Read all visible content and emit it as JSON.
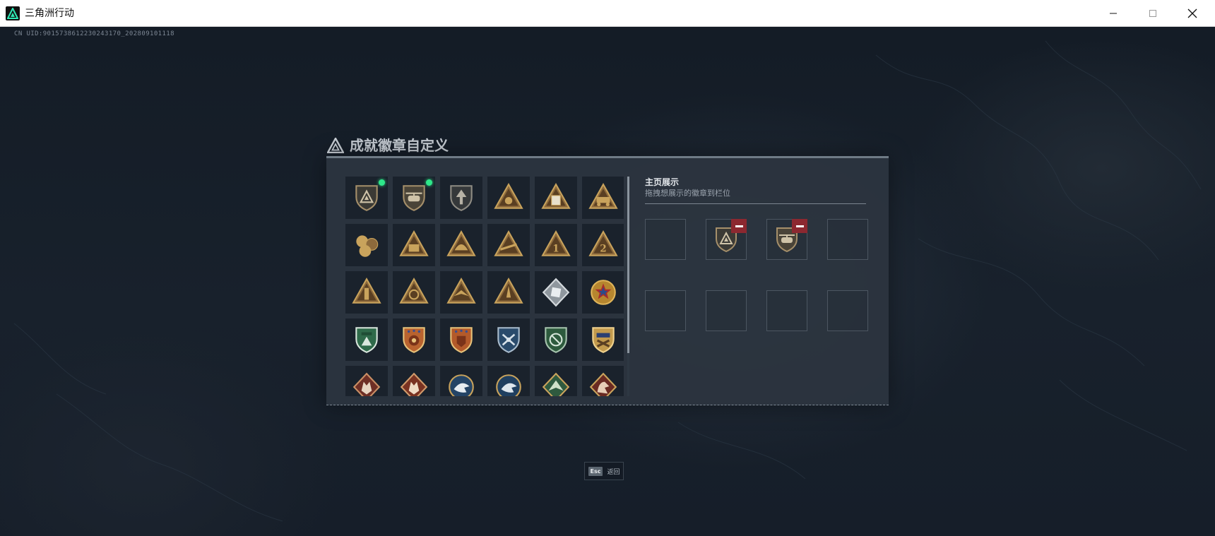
{
  "window": {
    "title": "三角洲行动",
    "controls": {
      "minimize": "minimize-icon",
      "maximize": "maximize-icon",
      "close": "close-icon"
    }
  },
  "uid_text": "CN UID:9015738612230243170_202809101118",
  "dialog": {
    "title": "成就徽章自定义",
    "badges": [
      {
        "icon": "shield-delta-badge",
        "new": true
      },
      {
        "icon": "helicopter-shield-badge",
        "new": true
      },
      {
        "icon": "arrowhead-shield-badge",
        "new": false
      },
      {
        "icon": "gold-triangle-badge",
        "new": false
      },
      {
        "icon": "triangle-card-badge",
        "new": false
      },
      {
        "icon": "triangle-vehicle-badge",
        "new": false
      },
      {
        "icon": "gold-cluster-badge",
        "new": false
      },
      {
        "icon": "triangle-kit-badge",
        "new": false
      },
      {
        "icon": "triangle-helmet-badge",
        "new": false
      },
      {
        "icon": "triangle-rifle-badge",
        "new": false
      },
      {
        "icon": "triangle-rank-1-badge",
        "new": false
      },
      {
        "icon": "triangle-rank-2-badge",
        "new": false
      },
      {
        "icon": "triangle-bottle-badge",
        "new": false
      },
      {
        "icon": "triangle-emblem-badge",
        "new": false
      },
      {
        "icon": "triangle-bird-badge",
        "new": false
      },
      {
        "icon": "triangle-rocket-badge",
        "new": false
      },
      {
        "icon": "silver-cube-badge",
        "new": false
      },
      {
        "icon": "red-star-medal-badge",
        "new": false
      },
      {
        "icon": "green-shield-badge",
        "new": false
      },
      {
        "icon": "orange-stars-shield-badge",
        "new": false
      },
      {
        "icon": "orange-stars-shield-2-badge",
        "new": false
      },
      {
        "icon": "blue-drone-shield-badge",
        "new": false
      },
      {
        "icon": "green-drone-shield-badge",
        "new": false
      },
      {
        "icon": "gold-crest-badge",
        "new": false
      },
      {
        "icon": "red-wolf-badge",
        "new": false
      },
      {
        "icon": "red-wolf-2-badge",
        "new": false
      },
      {
        "icon": "blue-eagle-badge",
        "new": false
      },
      {
        "icon": "blue-eagle-2-badge",
        "new": false
      },
      {
        "icon": "green-bird-badge",
        "new": false
      },
      {
        "icon": "red-dragon-badge",
        "new": false
      }
    ],
    "homepage": {
      "title": "主页展示",
      "subtitle": "拖拽想展示的徽章到栏位",
      "slots": [
        {
          "badge": null
        },
        {
          "badge": "shield-delta-badge"
        },
        {
          "badge": "helicopter-shield-badge"
        },
        {
          "badge": null
        },
        {
          "badge": null
        },
        {
          "badge": null
        },
        {
          "badge": null
        },
        {
          "badge": null
        }
      ]
    }
  },
  "footer": {
    "key": "Esc",
    "label": "返回"
  },
  "colors": {
    "gold": "#c9a35c",
    "bronze": "#8d6a3c",
    "new_dot": "#2ee88a",
    "remove": "#8c2830",
    "panel": "#2c353f"
  }
}
